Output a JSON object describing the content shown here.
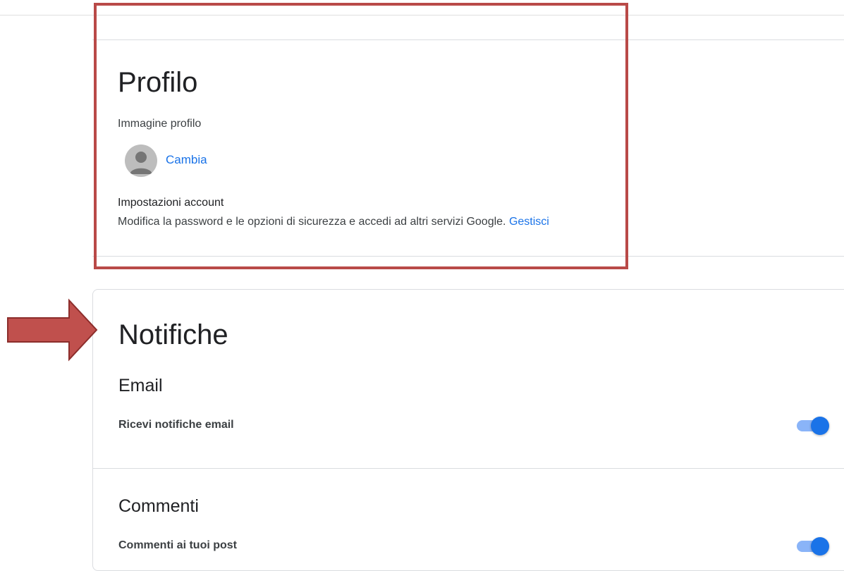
{
  "profile": {
    "title": "Profilo",
    "image_label": "Immagine profilo",
    "change_label": "Cambia",
    "account_label": "Impostazioni account",
    "account_description": "Modifica la password e le opzioni di sicurezza e accedi ad altri servizi Google. ",
    "manage_label": "Gestisci"
  },
  "notifications": {
    "title": "Notifiche",
    "email": {
      "heading": "Email",
      "row_label": "Ricevi notifiche email",
      "enabled": true
    },
    "comments": {
      "heading": "Commenti",
      "row_label": "Commenti ai tuoi post",
      "enabled": true
    }
  },
  "colors": {
    "accent": "#1a73e8",
    "toggle_track": "#8ab4f8",
    "annotation_red": "#b94a48"
  },
  "icons": {
    "avatar": "person-avatar-icon",
    "annotation_arrow": "arrow-right-icon"
  }
}
